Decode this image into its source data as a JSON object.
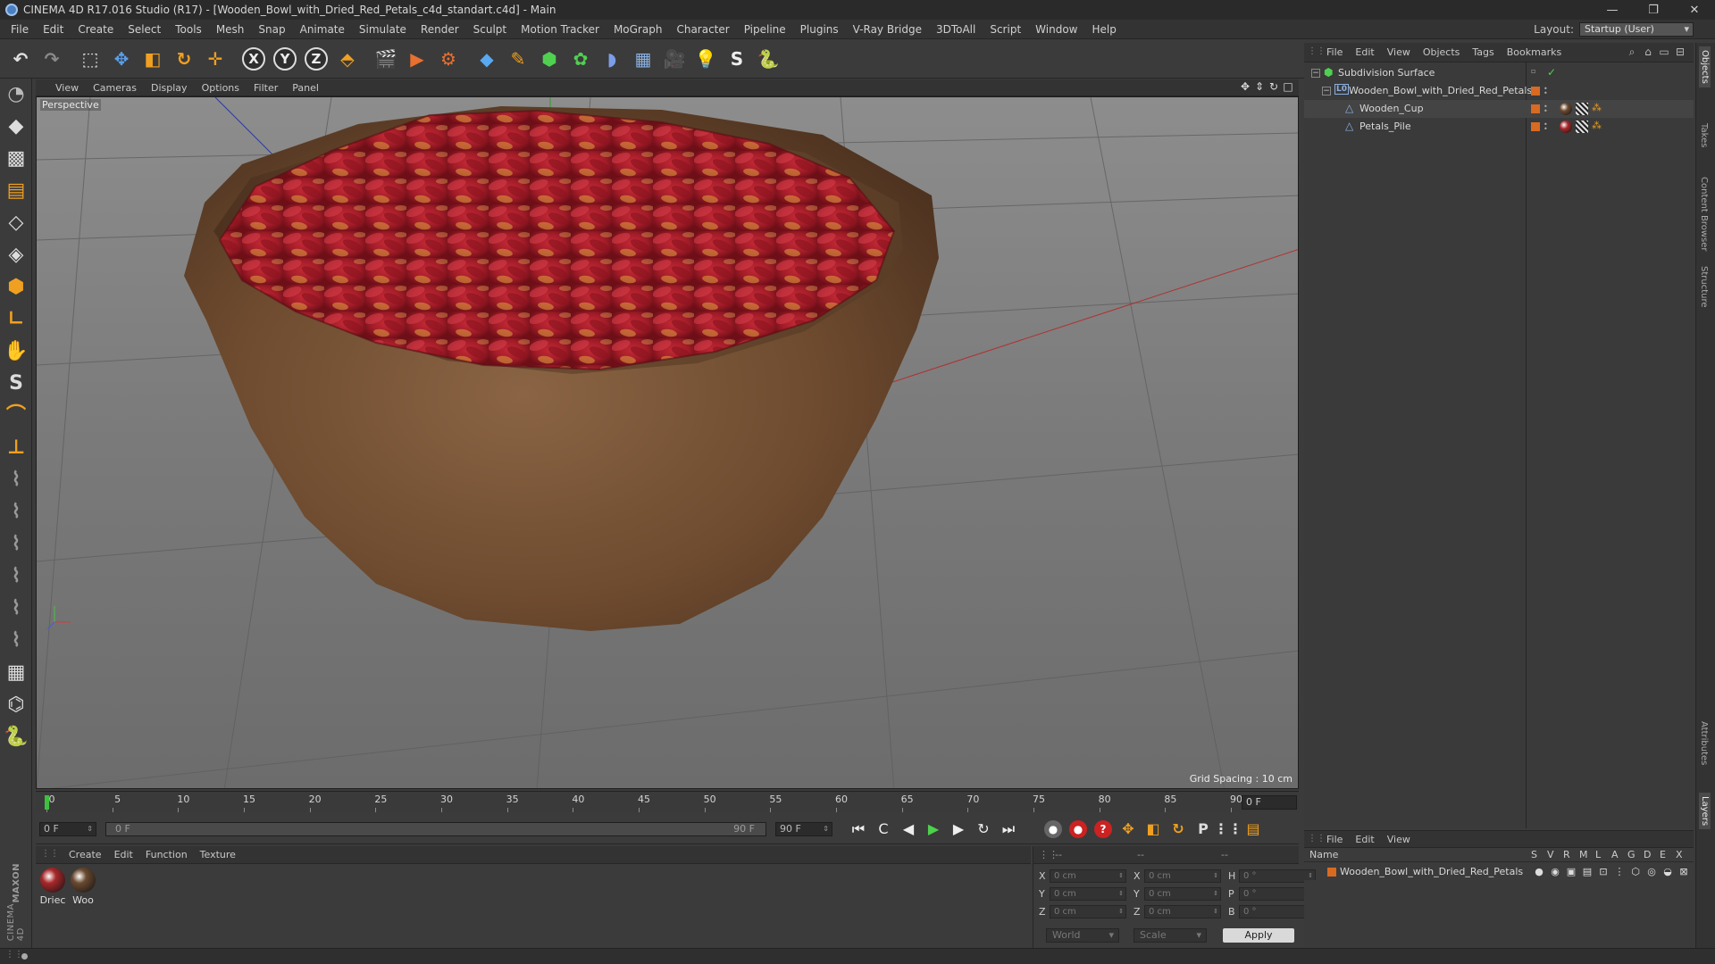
{
  "window": {
    "title": "CINEMA 4D R17.016 Studio (R17) - [Wooden_Bowl_with_Dried_Red_Petals_c4d_standart.c4d] - Main",
    "controls": [
      "—",
      "❐",
      "✕"
    ]
  },
  "menubar": {
    "items": [
      "File",
      "Edit",
      "Create",
      "Select",
      "Tools",
      "Mesh",
      "Snap",
      "Animate",
      "Simulate",
      "Render",
      "Sculpt",
      "Motion Tracker",
      "MoGraph",
      "Character",
      "Pipeline",
      "Plugins",
      "V-Ray Bridge",
      "3DToAll",
      "Script",
      "Window",
      "Help"
    ],
    "layout_label": "Layout:",
    "layout_value": "Startup (User)"
  },
  "toolbar": {
    "icons": [
      {
        "name": "undo-icon",
        "glyph": "↶",
        "color": "#e0e0e0"
      },
      {
        "name": "redo-icon",
        "glyph": "↷",
        "color": "#8a8a8a"
      },
      {
        "name": "live-selection-icon",
        "glyph": "⬚",
        "color": "#e0e0e0"
      },
      {
        "name": "move-icon",
        "glyph": "✥",
        "color": "#5aa0ef"
      },
      {
        "name": "scale-icon",
        "glyph": "◧",
        "color": "#f0a020"
      },
      {
        "name": "rotate-icon",
        "glyph": "↻",
        "color": "#f0a020"
      },
      {
        "name": "transform-icon",
        "glyph": "✛",
        "color": "#f0a020"
      },
      {
        "name": "x-axis-icon",
        "glyph": "X",
        "color": "#eeeeee"
      },
      {
        "name": "y-axis-icon",
        "glyph": "Y",
        "color": "#eeeeee"
      },
      {
        "name": "z-axis-icon",
        "glyph": "Z",
        "color": "#eeeeee"
      },
      {
        "name": "coordinate-system-icon",
        "glyph": "⬘",
        "color": "#f0a020"
      },
      {
        "name": "render-view-icon",
        "glyph": "🎬",
        "color": "#dddddd"
      },
      {
        "name": "render-picture-viewer-icon",
        "glyph": "▶",
        "color": "#e87030"
      },
      {
        "name": "edit-render-settings-icon",
        "glyph": "⚙",
        "color": "#e87030"
      },
      {
        "name": "cube-icon",
        "glyph": "◆",
        "color": "#5aa8ef"
      },
      {
        "name": "pen-spline-icon",
        "glyph": "✎",
        "color": "#f0a020"
      },
      {
        "name": "subdivision-icon",
        "glyph": "⬢",
        "color": "#50d050"
      },
      {
        "name": "cloner-icon",
        "glyph": "✿",
        "color": "#50d050"
      },
      {
        "name": "deformer-icon",
        "glyph": "◗",
        "color": "#7a9ee8"
      },
      {
        "name": "floor-icon",
        "glyph": "▦",
        "color": "#8ab0e0"
      },
      {
        "name": "camera-icon",
        "glyph": "🎥",
        "color": "#dddddd"
      },
      {
        "name": "light-icon",
        "glyph": "💡",
        "color": "#eeeeee"
      },
      {
        "name": "vray-icon",
        "glyph": "S",
        "color": "#eeeeee"
      },
      {
        "name": "python-icon",
        "glyph": "🐍",
        "color": "#7aa8e8"
      }
    ]
  },
  "lefttools": {
    "icons": [
      {
        "name": "make-editable-icon",
        "glyph": "◔",
        "color": "#bbbbbb"
      },
      {
        "name": "model-mode-icon",
        "glyph": "◆",
        "color": "#dddddd"
      },
      {
        "name": "texture-mode-icon",
        "glyph": "▩",
        "color": "#dddddd"
      },
      {
        "name": "workplane-icon",
        "glyph": "▤",
        "color": "#f0a020"
      },
      {
        "name": "points-mode-icon",
        "glyph": "◇",
        "color": "#dddddd"
      },
      {
        "name": "edges-mode-icon",
        "glyph": "◈",
        "color": "#dddddd"
      },
      {
        "name": "polygons-mode-icon",
        "glyph": "⬢",
        "color": "#f0a020"
      },
      {
        "name": "axis-mode-icon",
        "glyph": "∟",
        "color": "#f0a020"
      },
      {
        "name": "tweak-mode-icon",
        "glyph": "✋",
        "color": "#dddddd"
      },
      {
        "name": "snap-icon",
        "glyph": "S",
        "color": "#dddddd"
      },
      {
        "name": "magnet-icon",
        "glyph": "⌒",
        "color": "#f0a020"
      },
      {
        "name": "workplane-axis-icon",
        "glyph": "⊥",
        "color": "#f0a020"
      },
      {
        "name": "brush-icon",
        "glyph": "⌇",
        "color": "#999999"
      },
      {
        "name": "sculpt-brush-icon",
        "glyph": "⌇",
        "color": "#999999"
      },
      {
        "name": "smooth-brush-icon",
        "glyph": "⌇",
        "color": "#999999"
      },
      {
        "name": "paint-brush-icon",
        "glyph": "⌇",
        "color": "#999999"
      },
      {
        "name": "pull-brush-icon",
        "glyph": "⌇",
        "color": "#999999"
      },
      {
        "name": "grab-brush-icon",
        "glyph": "⌇",
        "color": "#999999"
      },
      {
        "name": "lock-workplane-icon",
        "glyph": "▦",
        "color": "#dddddd"
      },
      {
        "name": "solo-icon",
        "glyph": "⌬",
        "color": "#dddddd"
      },
      {
        "name": "python-console-icon",
        "glyph": "🐍",
        "color": "#7aa8e8"
      }
    ],
    "logo_brand": "MAXON",
    "logo_product": "CINEMA 4D"
  },
  "viewport": {
    "menu": [
      "View",
      "Cameras",
      "Display",
      "Options",
      "Filter",
      "Panel"
    ],
    "view_label": "Perspective",
    "grid_spacing": "Grid Spacing : 10 cm",
    "nav_icons": [
      "✥",
      "⇕",
      "↻",
      "□"
    ]
  },
  "timeline": {
    "ticks": [
      0,
      5,
      10,
      15,
      20,
      25,
      30,
      35,
      40,
      45,
      50,
      55,
      60,
      65,
      70,
      75,
      80,
      85,
      90
    ],
    "current_frame": "0 F",
    "max_frame": 90
  },
  "transport": {
    "start_field": "0 F",
    "range_start": "0 F",
    "range_end": "90 F",
    "end_field": "90 F",
    "buttons": [
      {
        "name": "go-to-start-icon",
        "glyph": "⏮"
      },
      {
        "name": "previous-key-icon",
        "glyph": "C"
      },
      {
        "name": "previous-frame-icon",
        "glyph": "◀"
      },
      {
        "name": "play-forward-icon",
        "glyph": "▶"
      },
      {
        "name": "next-frame-icon",
        "glyph": "▶"
      },
      {
        "name": "next-key-icon",
        "glyph": "↻"
      },
      {
        "name": "go-to-end-icon",
        "glyph": "⏭"
      }
    ],
    "record_buttons": [
      {
        "name": "record-key-disabled-icon",
        "glyph": "●",
        "color": "#666666"
      },
      {
        "name": "record-active-objects-icon",
        "glyph": "●",
        "color": "#cc2222"
      },
      {
        "name": "autokeying-icon",
        "glyph": "?",
        "color": "#cc2222"
      },
      {
        "name": "key-position-icon",
        "glyph": "✥",
        "color": "#f0a020"
      },
      {
        "name": "key-scale-icon",
        "glyph": "◧",
        "color": "#f0a020"
      },
      {
        "name": "key-rotation-icon",
        "glyph": "↻",
        "color": "#f0a020"
      },
      {
        "name": "key-parameter-icon",
        "glyph": "P",
        "color": "#dddddd"
      },
      {
        "name": "key-pla-icon",
        "glyph": "⋮⋮",
        "color": "#dddddd"
      },
      {
        "name": "timeline-window-icon",
        "glyph": "▤",
        "color": "#f0a020"
      }
    ]
  },
  "materials": {
    "menu": [
      "Create",
      "Edit",
      "Function",
      "Texture"
    ],
    "items": [
      {
        "name": "Driec",
        "color": "#a8282a"
      },
      {
        "name": "Woo",
        "color": "#6a4a30"
      }
    ]
  },
  "coordinates": {
    "head": [
      "--",
      "--",
      "--"
    ],
    "rows": [
      {
        "a": "X",
        "av": "0 cm",
        "b": "X",
        "bv": "0 cm",
        "c": "H",
        "cv": "0 °"
      },
      {
        "a": "Y",
        "av": "0 cm",
        "b": "Y",
        "bv": "0 cm",
        "c": "P",
        "cv": "0 °"
      },
      {
        "a": "Z",
        "av": "0 cm",
        "b": "Z",
        "bv": "0 cm",
        "c": "B",
        "cv": "0 °"
      }
    ],
    "space": "World",
    "mode": "Scale",
    "apply": "Apply"
  },
  "objects": {
    "menu": [
      "File",
      "Edit",
      "View",
      "Objects",
      "Tags",
      "Bookmarks"
    ],
    "tree": [
      {
        "name": "Subdivision Surface",
        "depth": 0,
        "icon": "⬢",
        "icon_color": "#50d050",
        "expander": "−",
        "tags": "check"
      },
      {
        "name": "Wooden_Bowl_with_Dried_Red_Petals",
        "depth": 1,
        "icon": "L0",
        "icon_color": "#8ab0e0",
        "expander": "−",
        "tags": "none"
      },
      {
        "name": "Wooden_Cup",
        "depth": 2,
        "icon": "△",
        "icon_color": "#8ab0e0",
        "expander": "",
        "tags": "wood"
      },
      {
        "name": "Petals_Pile",
        "depth": 2,
        "icon": "△",
        "icon_color": "#8ab0e0",
        "expander": "",
        "tags": "petal"
      }
    ]
  },
  "side_tabs": [
    "Objects",
    "Takes",
    "Content Browser",
    "Structure",
    "Attributes",
    "Layers"
  ],
  "layers": {
    "menu": [
      "File",
      "Edit",
      "View"
    ],
    "headers": [
      "Name",
      "S",
      "V",
      "R",
      "M",
      "L",
      "A",
      "G",
      "D",
      "E",
      "X"
    ],
    "row_name": "Wooden_Bowl_with_Dried_Red_Petals"
  }
}
